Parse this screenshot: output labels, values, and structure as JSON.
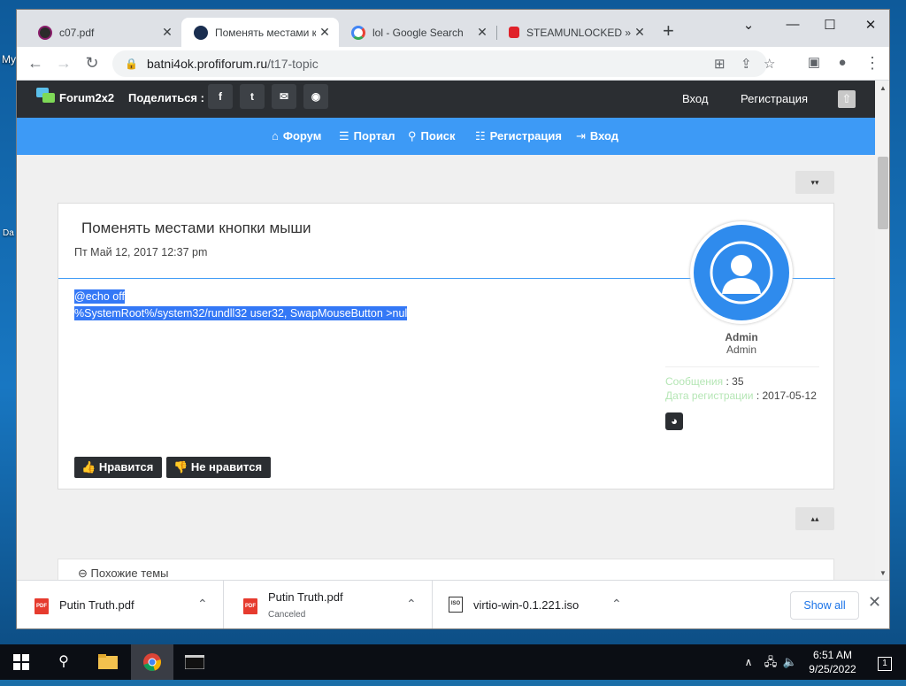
{
  "desktop": {
    "labels": [
      "My",
      "Da"
    ]
  },
  "tabs": [
    {
      "title": "c07.pdf",
      "close": "✕",
      "favicon_color": "#2b2b2b"
    },
    {
      "title": "Поменять местами к",
      "close": "✕",
      "favicon_color": "#1a2e50"
    },
    {
      "title": "lol - Google Search",
      "close": "✕",
      "favicon_color": "#ffffff"
    },
    {
      "title": "STEAMUNLOCKED »",
      "close": "✕",
      "favicon_color": "#e0222a"
    }
  ],
  "window_controls": {
    "tab_search": "⌄",
    "minimize": "—",
    "maximize": "☐",
    "close": "✕",
    "new_tab": "+"
  },
  "toolbar": {
    "back": "←",
    "forward": "→",
    "reload": "↻",
    "url_domain": "batni4ok.profiforum.ru",
    "url_path": "/t17-topic",
    "lock": "🔒"
  },
  "forum": {
    "brand": "Forum2x2",
    "share_label": "Поделиться :",
    "share_buttons": [
      "f",
      "t",
      "✉",
      "◉"
    ],
    "login": "Вход",
    "register": "Регистрация",
    "up_icon": "⇧",
    "nav": [
      {
        "icon": "⌂",
        "label": "Форум"
      },
      {
        "icon": "☰",
        "label": "Портал"
      },
      {
        "icon": "⚲",
        "label": "Поиск"
      },
      {
        "icon": "☷",
        "label": "Регистрация"
      },
      {
        "icon": "⇥",
        "label": "Вход"
      }
    ],
    "jump_down": "▾▾",
    "jump_up": "▴▴"
  },
  "post": {
    "title": "Поменять местами кнопки мыши",
    "date": "Пт Май 12, 2017 12:37 pm",
    "code_lines": [
      "@echo off",
      "%SystemRoot%/system32/rundll32 user32, SwapMouseButton >nul"
    ],
    "author": "Admin",
    "rank": "Admin",
    "messages_label": "Сообщения",
    "messages_value": ": 35",
    "registered_label": "Дата регистрации",
    "registered_value": ": 2017-05-12",
    "like": "Нравится",
    "dislike": "Не нравится",
    "like_icon": "👍",
    "dislike_icon": "👎"
  },
  "similar": {
    "icon": "⊖",
    "title": "Похожие темы"
  },
  "downloads": [
    {
      "name": "Putin Truth.pdf",
      "status": "",
      "type": "PDF"
    },
    {
      "name": "Putin Truth.pdf",
      "status": "Canceled",
      "type": "PDF"
    },
    {
      "name": "virtio-win-0.1.221.iso",
      "status": "",
      "type": "ISO"
    }
  ],
  "downloads_bar": {
    "show_all": "Show all",
    "close": "✕",
    "chevron": "⌃"
  },
  "taskbar": {
    "time": "6:51 AM",
    "date": "9/25/2022",
    "notification_count": "1"
  }
}
